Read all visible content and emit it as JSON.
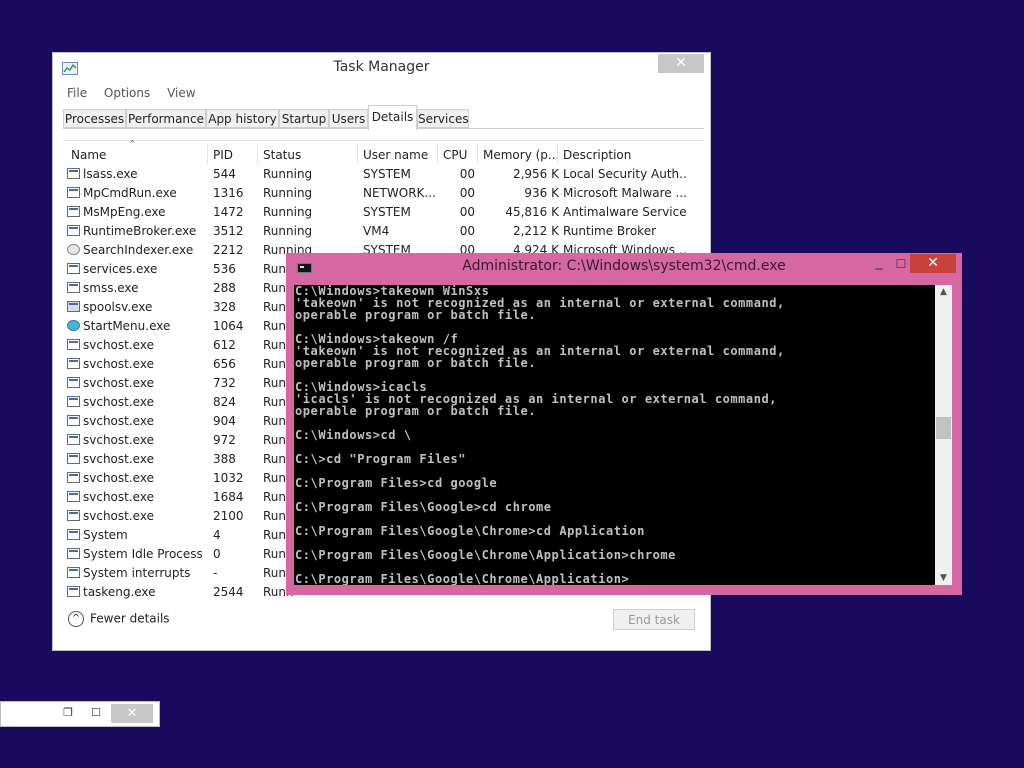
{
  "task_manager": {
    "title": "Task Manager",
    "close_glyph": "✕",
    "menu": [
      "File",
      "Options",
      "View"
    ],
    "tabs": [
      "Processes",
      "Performance",
      "App history",
      "Startup",
      "Users",
      "Details",
      "Services"
    ],
    "active_tab": "Details",
    "columns": [
      "Name",
      "PID",
      "Status",
      "User name",
      "CPU",
      "Memory (p...",
      "Description"
    ],
    "sort_glyph": "^",
    "rows": [
      {
        "name": "lsass.exe",
        "pid": "544",
        "status": "Running",
        "user": "SYSTEM",
        "cpu": "00",
        "mem": "2,956 K",
        "desc": "Local Security Auth...",
        "icon": "window-icon"
      },
      {
        "name": "MpCmdRun.exe",
        "pid": "1316",
        "status": "Running",
        "user": "NETWORK...",
        "cpu": "00",
        "mem": "936 K",
        "desc": "Microsoft Malware ...",
        "icon": "window-icon"
      },
      {
        "name": "MsMpEng.exe",
        "pid": "1472",
        "status": "Running",
        "user": "SYSTEM",
        "cpu": "00",
        "mem": "45,816 K",
        "desc": "Antimalware Service...",
        "icon": "window-icon"
      },
      {
        "name": "RuntimeBroker.exe",
        "pid": "3512",
        "status": "Running",
        "user": "VM4",
        "cpu": "00",
        "mem": "2,212 K",
        "desc": "Runtime Broker",
        "icon": "window-icon"
      },
      {
        "name": "SearchIndexer.exe",
        "pid": "2212",
        "status": "Running",
        "user": "SYSTEM",
        "cpu": "00",
        "mem": "4,924 K",
        "desc": "Microsoft Windows ...",
        "icon": "search-icon"
      },
      {
        "name": "services.exe",
        "pid": "536",
        "status": "Runn",
        "icon": "window-icon"
      },
      {
        "name": "smss.exe",
        "pid": "288",
        "status": "Runn",
        "icon": "window-icon"
      },
      {
        "name": "spoolsv.exe",
        "pid": "328",
        "status": "Runn",
        "icon": "printer-icon"
      },
      {
        "name": "StartMenu.exe",
        "pid": "1064",
        "status": "Runn",
        "icon": "globe-icon"
      },
      {
        "name": "svchost.exe",
        "pid": "612",
        "status": "Runn",
        "icon": "window-icon"
      },
      {
        "name": "svchost.exe",
        "pid": "656",
        "status": "Runn",
        "icon": "window-icon"
      },
      {
        "name": "svchost.exe",
        "pid": "732",
        "status": "Runn",
        "icon": "window-icon"
      },
      {
        "name": "svchost.exe",
        "pid": "824",
        "status": "Runn",
        "icon": "window-icon"
      },
      {
        "name": "svchost.exe",
        "pid": "904",
        "status": "Runn",
        "icon": "window-icon"
      },
      {
        "name": "svchost.exe",
        "pid": "972",
        "status": "Runn",
        "icon": "window-icon"
      },
      {
        "name": "svchost.exe",
        "pid": "388",
        "status": "Runn",
        "icon": "window-icon"
      },
      {
        "name": "svchost.exe",
        "pid": "1032",
        "status": "Runn",
        "icon": "window-icon"
      },
      {
        "name": "svchost.exe",
        "pid": "1684",
        "status": "Runn",
        "icon": "window-icon"
      },
      {
        "name": "svchost.exe",
        "pid": "2100",
        "status": "Runn",
        "icon": "window-icon"
      },
      {
        "name": "System",
        "pid": "4",
        "status": "Runn",
        "icon": "window-icon"
      },
      {
        "name": "System Idle Process",
        "pid": "0",
        "status": "Runn",
        "icon": "window-icon"
      },
      {
        "name": "System interrupts",
        "pid": "-",
        "status": "Runn",
        "icon": "window-icon"
      },
      {
        "name": "taskeng.exe",
        "pid": "2544",
        "status": "Runn",
        "icon": "window-icon"
      }
    ],
    "fewer_details_glyph": "^",
    "fewer_details": "Fewer details",
    "end_task": "End task"
  },
  "cmd": {
    "title": "Administrator: C:\\Windows\\system32\\cmd.exe",
    "min_glyph": "_",
    "max_glyph": "☐",
    "close_glyph": "✕",
    "lines": [
      "C:\\Windows>takeown WinSxs",
      "'takeown' is not recognized as an internal or external command,",
      "operable program or batch file.",
      "",
      "C:\\Windows>takeown /f",
      "'takeown' is not recognized as an internal or external command,",
      "operable program or batch file.",
      "",
      "C:\\Windows>icacls",
      "'icacls' is not recognized as an internal or external command,",
      "operable program or batch file.",
      "",
      "C:\\Windows>cd \\",
      "",
      "C:\\>cd \"Program Files\"",
      "",
      "C:\\Program Files>cd google",
      "",
      "C:\\Program Files\\Google>cd chrome",
      "",
      "C:\\Program Files\\Google\\Chrome>cd Application",
      "",
      "C:\\Program Files\\Google\\Chrome\\Application>chrome",
      "",
      "C:\\Program Files\\Google\\Chrome\\Application>"
    ],
    "scroll_up_glyph": "▲",
    "scroll_down_glyph": "▼"
  },
  "minimized": {
    "restore_glyph": "❐",
    "max_glyph": "☐",
    "close_glyph": "✕"
  },
  "colors": {
    "desktop": "#1a0a5e",
    "cmd_frame": "#d567a3",
    "cmd_close": "#c8413a"
  }
}
